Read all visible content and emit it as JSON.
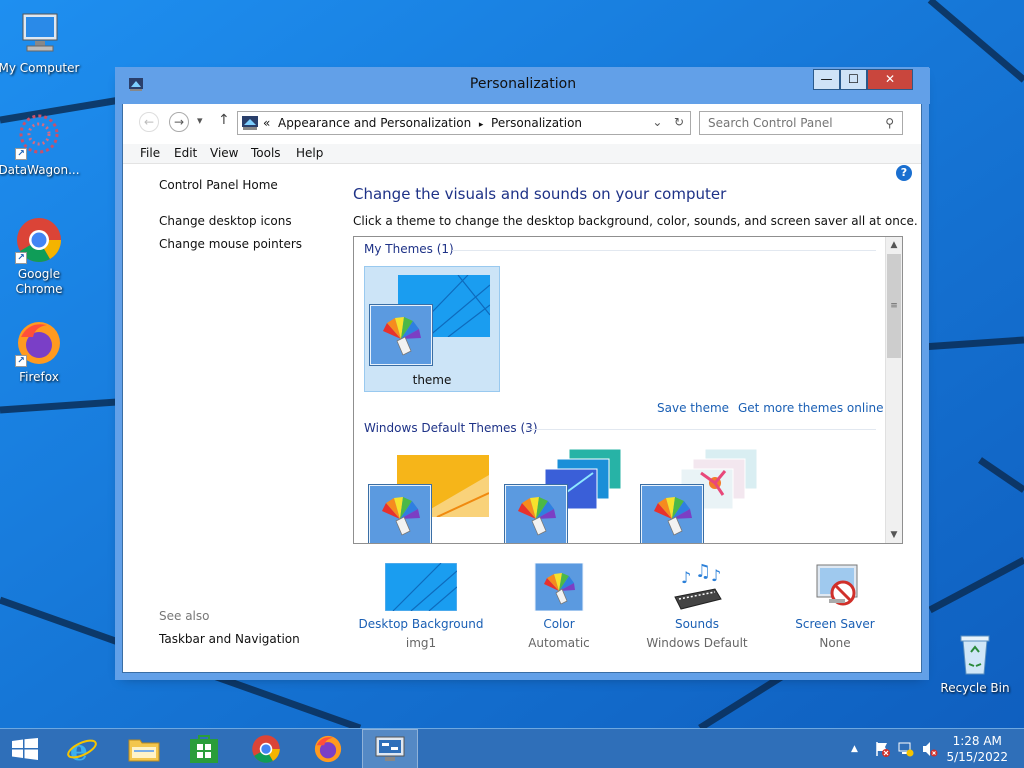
{
  "desktop": {
    "icons": [
      {
        "label": "My Computer",
        "icon": "computer-icon"
      },
      {
        "label": "DataWagon...",
        "icon": "datawagon-icon"
      },
      {
        "label": "Google Chrome",
        "icon": "chrome-icon"
      },
      {
        "label": "Firefox",
        "icon": "firefox-icon"
      },
      {
        "label": "Recycle Bin",
        "icon": "recycle-bin-icon"
      }
    ]
  },
  "window": {
    "title": "Personalization",
    "controls": {
      "minimize": "—",
      "maximize": "☐",
      "close": "✕"
    }
  },
  "navigation": {
    "back": "←",
    "forward": "→",
    "recent": "▾",
    "up": "↑",
    "breadcrumb_prefix": "«",
    "breadcrumb": [
      "Appearance and Personalization",
      "Personalization"
    ],
    "breadcrumb_separator": "▸",
    "search_placeholder": "Search Control Panel"
  },
  "menu": [
    "File",
    "Edit",
    "View",
    "Tools",
    "Help"
  ],
  "left_nav": {
    "home": "Control Panel Home",
    "links": [
      "Change desktop icons",
      "Change mouse pointers"
    ],
    "see_also_label": "See also",
    "see_also_links": [
      "Taskbar and Navigation"
    ]
  },
  "main": {
    "heading": "Change the visuals and sounds on your computer",
    "subtitle": "Click a theme to change the desktop background, color, sounds, and screen saver all at once.",
    "help": "?",
    "groups": [
      {
        "title": "My Themes (1)",
        "themes": [
          {
            "label": "theme",
            "selected": true
          }
        ]
      },
      {
        "title": "Windows Default Themes (3)",
        "themes": [
          {
            "label": ""
          },
          {
            "label": ""
          },
          {
            "label": ""
          }
        ]
      }
    ],
    "links": {
      "save": "Save theme",
      "more": "Get more themes online"
    },
    "scroll": {
      "up": "▲",
      "down": "▼",
      "grip": "≡"
    }
  },
  "bottom": [
    {
      "name": "Desktop Background",
      "value": "img1",
      "icon": "desktop-background-icon"
    },
    {
      "name": "Color",
      "value": "Automatic",
      "icon": "color-icon"
    },
    {
      "name": "Sounds",
      "value": "Windows Default",
      "icon": "sounds-icon"
    },
    {
      "name": "Screen Saver",
      "value": "None",
      "icon": "screen-saver-icon"
    }
  ],
  "taskbar": {
    "apps": [
      "start-icon",
      "internet-explorer-icon",
      "file-explorer-icon",
      "store-icon",
      "chrome-icon",
      "firefox-icon",
      "control-panel-icon"
    ],
    "tray": {
      "up_arrow": "▲",
      "time": "1:28 AM",
      "date": "5/15/2022"
    }
  },
  "colors": {
    "wallpaper": "#1a7fe0",
    "titlebar": "#62a0e8",
    "link": "#1a5fb4",
    "heading": "#1e3287",
    "taskbar": "#2f6fb9",
    "close_button": "#c9463d"
  }
}
